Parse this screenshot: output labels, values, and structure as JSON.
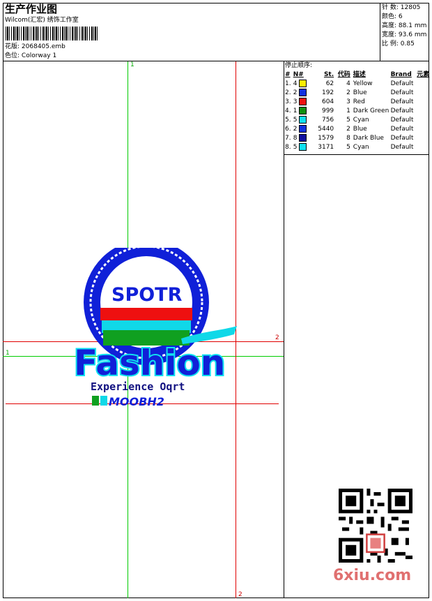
{
  "header": {
    "title": "生产作业图",
    "company": "Wilcom(汇宏) 绣饰工作室",
    "design_label": "花版:",
    "design_file": "2068405.emb",
    "colorway_label": "色位:",
    "colorway": "Colorway 1"
  },
  "stats": [
    {
      "label": "针 数:",
      "value": "12805"
    },
    {
      "label": "颜色:",
      "value": "6"
    },
    {
      "label": "高度:",
      "value": "88.1 mm"
    },
    {
      "label": "宽度:",
      "value": "93.6 mm"
    },
    {
      "label": "比 例:",
      "value": "0.85"
    }
  ],
  "sequence": {
    "title": "停止顺序:",
    "columns": [
      "#",
      "N#",
      "St.",
      "代码",
      "描述",
      "Brand",
      "元素"
    ],
    "rows": [
      {
        "idx": "1.",
        "n": "4",
        "color": "#ffee00",
        "st": "62",
        "code": "4",
        "desc": "Yellow",
        "brand": "Default"
      },
      {
        "idx": "2.",
        "n": "2",
        "color": "#1030e0",
        "st": "192",
        "code": "2",
        "desc": "Blue",
        "brand": "Default"
      },
      {
        "idx": "3.",
        "n": "3",
        "color": "#ee1010",
        "st": "604",
        "code": "3",
        "desc": "Red",
        "brand": "Default"
      },
      {
        "idx": "4.",
        "n": "1",
        "color": "#109010",
        "st": "999",
        "code": "1",
        "desc": "Dark Green",
        "brand": "Default"
      },
      {
        "idx": "5.",
        "n": "5",
        "color": "#10e0f0",
        "st": "756",
        "code": "5",
        "desc": "Cyan",
        "brand": "Default"
      },
      {
        "idx": "6.",
        "n": "2",
        "color": "#1030e0",
        "st": "5440",
        "code": "2",
        "desc": "Blue",
        "brand": "Default"
      },
      {
        "idx": "7.",
        "n": "8",
        "color": "#1010a0",
        "st": "1579",
        "code": "8",
        "desc": "Dark Blue",
        "brand": "Default"
      },
      {
        "idx": "8.",
        "n": "5",
        "color": "#10e0f0",
        "st": "3171",
        "code": "5",
        "desc": "Cyan",
        "brand": "Default"
      }
    ]
  },
  "design": {
    "badge_text": "SPOTR",
    "main_text": "Fashion",
    "sub_text": "Experience Oqrt",
    "code_text": "MOOBH2"
  },
  "guides": {
    "green_top": "1",
    "green_left": "1",
    "red_right": "2",
    "red_bottom": "2"
  },
  "watermark": "6xiu.com"
}
